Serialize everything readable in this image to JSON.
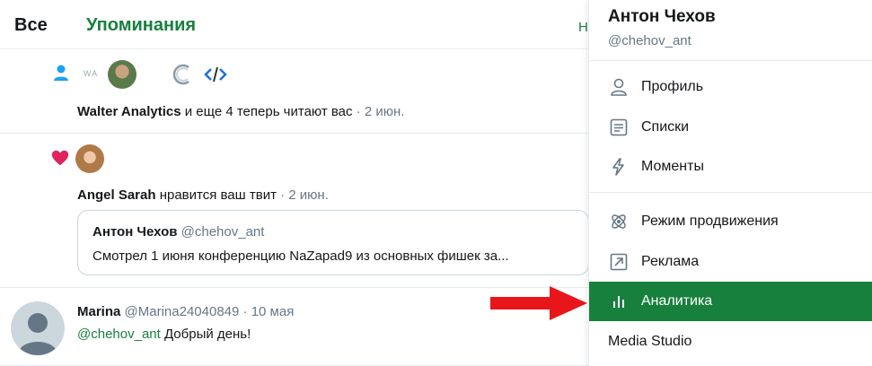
{
  "tabs": {
    "all": "Все",
    "mentions": "Упоминания",
    "extra": "Н"
  },
  "notifications": [
    {
      "logo_text": "WA",
      "actor": "Walter Analytics",
      "text": " и еще 4 теперь читают вас",
      "date": " · 2 июн."
    },
    {
      "actor": "Angel Sarah",
      "text": " нравится ваш твит",
      "date": " · 2 июн.",
      "quote": {
        "name": "Антон Чехов",
        "handle": "@chehov_ant",
        "text": "Смотрел 1 июня конференцию NaZapad9 из основных фишек за..."
      }
    },
    {
      "name": "Marina",
      "handle": "@Marina24040849",
      "date": " · 10 мая",
      "mention": "@chehov_ant",
      "text": " Добрый день!"
    }
  ],
  "menu": {
    "name": "Антон Чехов",
    "handle": "@chehov_ant",
    "items": [
      {
        "label": "Профиль",
        "icon": "person-icon"
      },
      {
        "label": "Списки",
        "icon": "list-icon"
      },
      {
        "label": "Моменты",
        "icon": "lightning-icon"
      },
      {
        "label": "Режим продвижения",
        "icon": "promote-icon"
      },
      {
        "label": "Реклама",
        "icon": "external-arrow-icon"
      },
      {
        "label": "Аналитика",
        "icon": "bar-chart-icon"
      }
    ],
    "media_studio": "Media Studio"
  },
  "colors": {
    "accent": "#17803d",
    "arrow": "#e8161b",
    "heart": "#e0245e",
    "person_icon": "#1da1f2"
  }
}
